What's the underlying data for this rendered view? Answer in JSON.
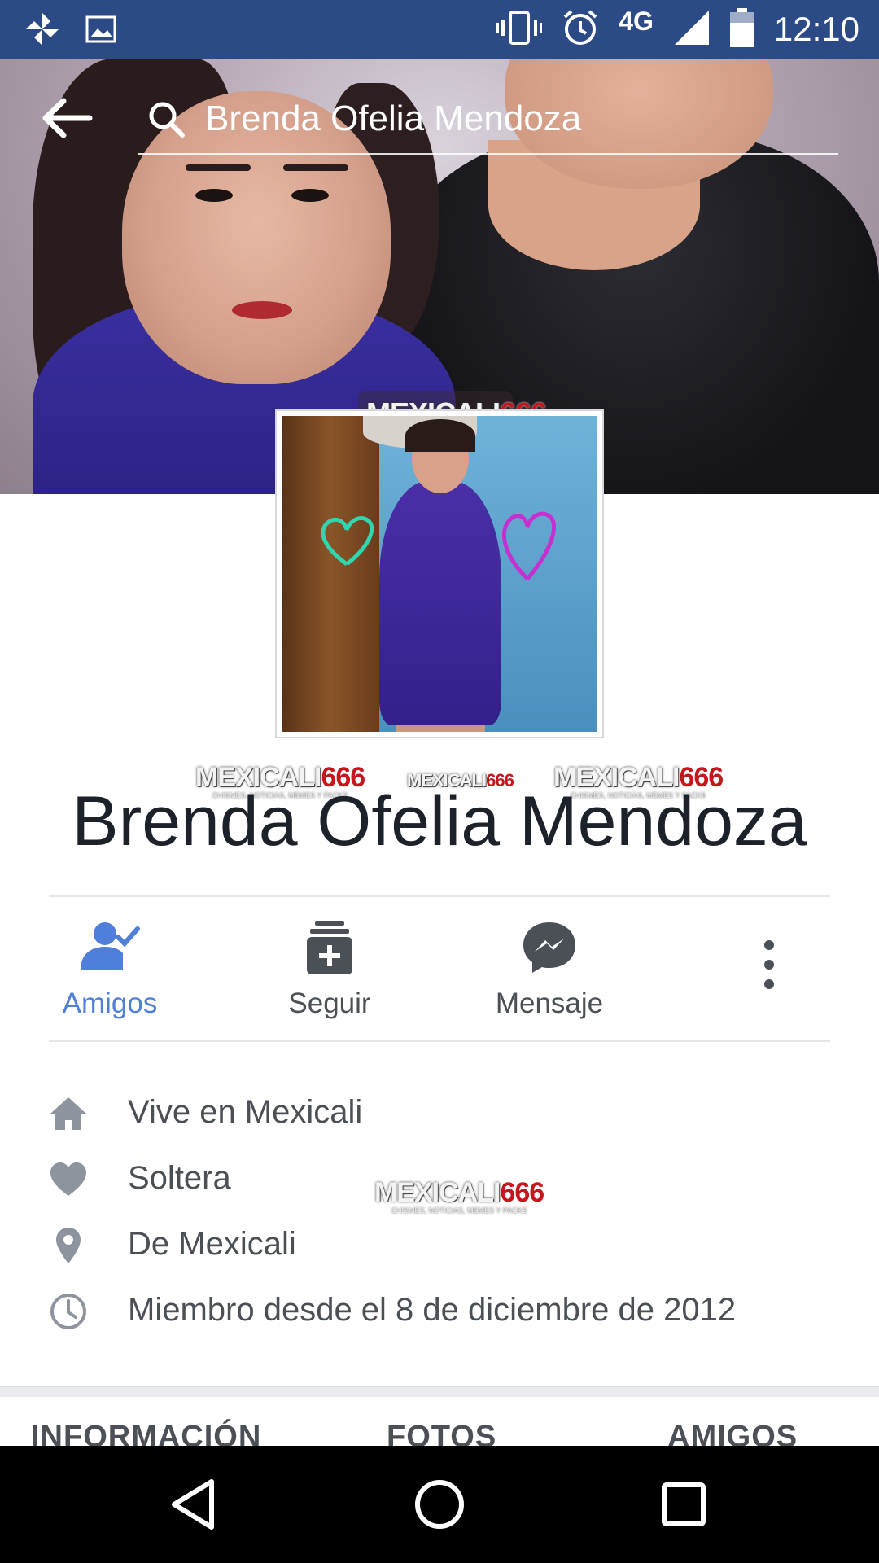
{
  "status_bar": {
    "network": "4G",
    "time": "12:10",
    "icons": [
      "pinwheel-icon",
      "image-icon",
      "vibrate-icon",
      "alarm-icon",
      "signal-icon",
      "battery-icon"
    ]
  },
  "search": {
    "value": "Brenda Ofelia Mendoza"
  },
  "watermark": {
    "text_a": "MEXICALI",
    "text_b": "666",
    "subtext": "CHISMES, NOTICIAS, MEMES Y PACKS",
    "brand_color": "#c4161c"
  },
  "profile": {
    "name": "Brenda Ofelia Mendoza"
  },
  "actions": [
    {
      "label": "Amigos",
      "icon": "friends-check-icon",
      "color": "#4f7fd8"
    },
    {
      "label": "Seguir",
      "icon": "follow-icon"
    },
    {
      "label": "Mensaje",
      "icon": "messenger-icon"
    },
    {
      "icon": "more-vertical-icon"
    }
  ],
  "info": [
    {
      "icon": "home-icon",
      "text": "Vive en Mexicali"
    },
    {
      "icon": "heart-icon",
      "text": "Soltera"
    },
    {
      "icon": "location-pin-icon",
      "text": "De Mexicali"
    },
    {
      "icon": "clock-icon",
      "text": "Miembro desde el 8 de diciembre de 2012"
    }
  ],
  "tabs": [
    {
      "label": "INFORMACIÓN"
    },
    {
      "label": "FOTOS"
    },
    {
      "label": "AMIGOS"
    }
  ],
  "colors": {
    "status_bar": "#2c4a86",
    "accent": "#4f7fd8",
    "text": "#4b4f56"
  }
}
